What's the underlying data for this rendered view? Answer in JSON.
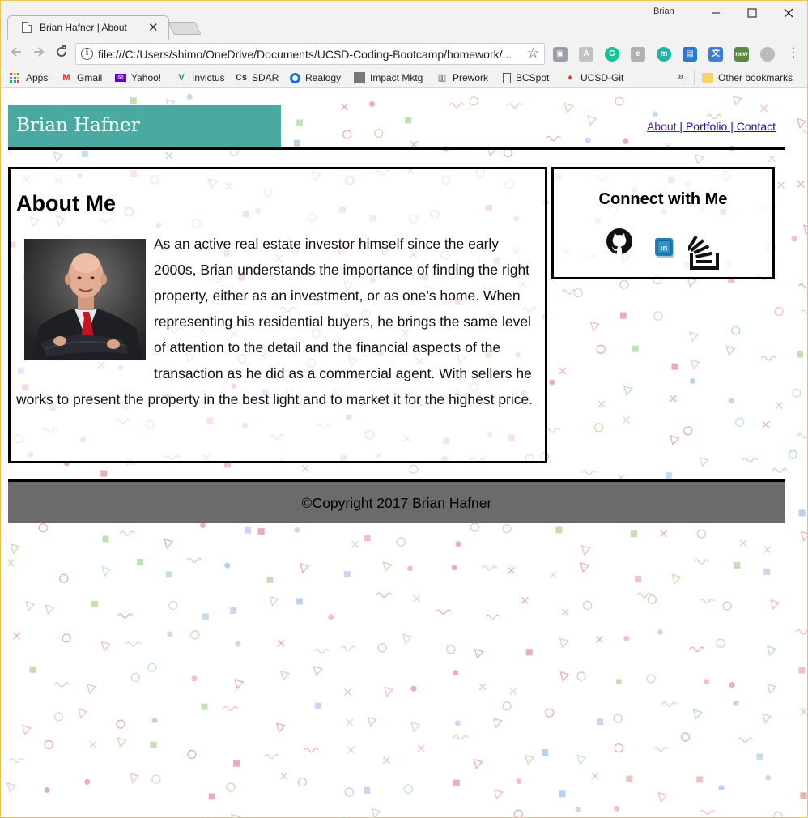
{
  "window": {
    "profile_name": "Brian",
    "tab_title": "Brian Hafner | About",
    "url": "file:///C:/Users/shimo/OneDrive/Documents/UCSD-Coding-Bootcamp/homework/..."
  },
  "bookmarks": {
    "items": [
      {
        "label": "Apps",
        "icon": "apps-grid-icon"
      },
      {
        "label": "Gmail",
        "icon": "gmail-icon"
      },
      {
        "label": "Yahoo!",
        "icon": "yahoo-mail-icon"
      },
      {
        "label": "Invictus",
        "icon": "invictus-icon"
      },
      {
        "label": "SDAR",
        "icon": "sdar-icon"
      },
      {
        "label": "Realogy",
        "icon": "realogy-icon"
      },
      {
        "label": "Impact Mktg",
        "icon": "image-icon"
      },
      {
        "label": "Prework",
        "icon": "book-icon"
      },
      {
        "label": "BCSpot",
        "icon": "page-icon"
      },
      {
        "label": "UCSD-Git",
        "icon": "gitlab-icon"
      }
    ],
    "other": "Other bookmarks",
    "new_badge": "new"
  },
  "site": {
    "brand": "Brian Hafner",
    "nav": {
      "about": "About",
      "sep": " | ",
      "portfolio": "Portfolio",
      "contact": "Contact"
    },
    "about": {
      "heading": "About Me",
      "body": "As an active real estate investor himself since the early 2000s, Brian understands the importance of finding the right property, either as an investment, or as one’s home. When representing his residential buyers, he brings the same level of attention to the detail and the financial aspects of the transaction as he did as a commercial agent. With sellers he works to present the property in the best light and to market it for the highest price."
    },
    "connect": {
      "heading": "Connect with Me",
      "links": [
        "github-icon",
        "linkedin-icon",
        "stackoverflow-icon"
      ]
    },
    "footer": "©Copyright 2017 Brian Hafner"
  },
  "colors": {
    "brand_bg": "#4aa9a0",
    "footer_bg": "#6b6b6b",
    "link": "#1a0dab",
    "visited_link": "#551a8b"
  }
}
